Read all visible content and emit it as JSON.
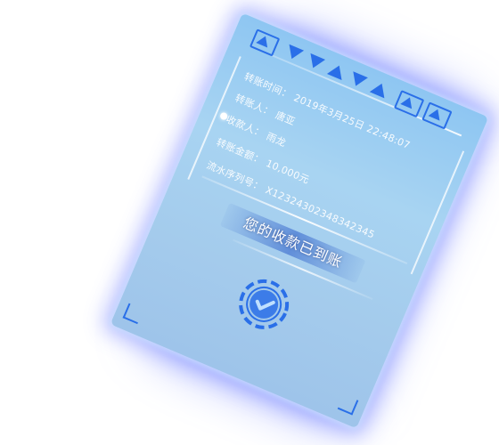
{
  "receipt": {
    "rows": [
      {
        "label": "转账时间：",
        "value": "2019年3月25日 22:48:07"
      },
      {
        "label": "转账人：",
        "value": "唐亚"
      },
      {
        "label": "收款人：",
        "value": "雨龙"
      },
      {
        "label": "转账金额：",
        "value": "10,000元"
      },
      {
        "label": "流水序列号：",
        "value": "X12324302348342345"
      }
    ],
    "status_message": "您的收款已到账"
  },
  "colors": {
    "accent": "#2a6fe8",
    "glow": "#6a7dff",
    "card_top": "#8ec6f2",
    "card_bottom": "#9ec4ea"
  },
  "icons": [
    "triangle-chevron-icon",
    "checkmark-badge-icon",
    "corner-bracket-icon"
  ]
}
